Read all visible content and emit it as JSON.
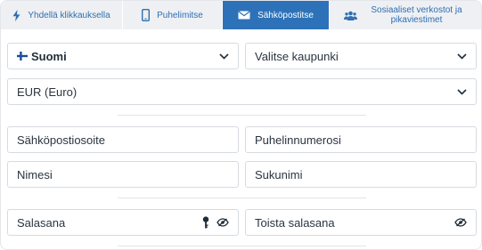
{
  "tabs": [
    {
      "label": "Yhdellä klikkauksella",
      "icon": "lightning-icon",
      "active": false
    },
    {
      "label": "Puhelimitse",
      "icon": "phone-icon",
      "active": false
    },
    {
      "label": "Sähköpostitse",
      "icon": "envelope-icon",
      "active": true
    },
    {
      "label": "Sosiaaliset verkostot ja pikaviestimet",
      "icon": "users-icon",
      "active": false
    }
  ],
  "country": {
    "value": "Suomi",
    "flag": "finland-flag-icon"
  },
  "city": {
    "placeholder": "Valitse kaupunki"
  },
  "currency": {
    "value": "EUR (Euro)"
  },
  "email": {
    "placeholder": "Sähköpostiosoite"
  },
  "phone": {
    "placeholder": "Puhelinnumerosi"
  },
  "first_name": {
    "placeholder": "Nimesi"
  },
  "last_name": {
    "placeholder": "Sukunimi"
  },
  "password": {
    "placeholder": "Salasana"
  },
  "repeat_password": {
    "placeholder": "Toista salasana"
  },
  "colors": {
    "accent": "#2d72b8",
    "tab_bg": "#eef0f3",
    "border": "#d7dbe0"
  }
}
